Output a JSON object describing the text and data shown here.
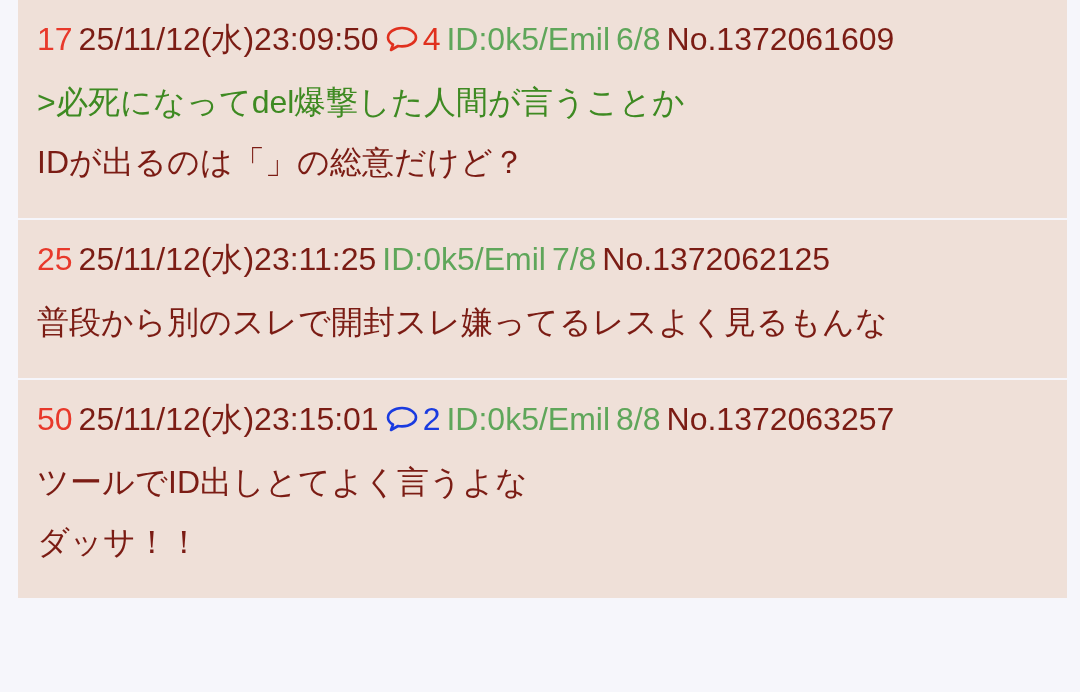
{
  "posts": [
    {
      "number": "17",
      "datetime": "25/11/12(水)23:09:50",
      "replies": {
        "count": "4",
        "color": "#e0301e"
      },
      "id": "ID:0k5/Emil",
      "id_count": "6/8",
      "post_no": "No.1372061609",
      "lines": [
        {
          "kind": "quote",
          "text": ">必死になってdel爆撃した人間が言うことか"
        },
        {
          "kind": "text",
          "text": "IDが出るのは「」の総意だけど？"
        }
      ]
    },
    {
      "number": "25",
      "datetime": "25/11/12(水)23:11:25",
      "id": "ID:0k5/Emil",
      "id_count": "7/8",
      "post_no": "No.1372062125",
      "lines": [
        {
          "kind": "text",
          "text": "普段から別のスレで開封スレ嫌ってるレスよく見るもんな"
        }
      ]
    },
    {
      "number": "50",
      "datetime": "25/11/12(水)23:15:01",
      "replies": {
        "count": "2",
        "color": "#1a3be0"
      },
      "id": "ID:0k5/Emil",
      "id_count": "8/8",
      "post_no": "No.1372063257",
      "lines": [
        {
          "kind": "text",
          "text": "ツールでID出しとてよく言うよな"
        },
        {
          "kind": "text",
          "text": "ダッサ！！"
        }
      ]
    }
  ]
}
